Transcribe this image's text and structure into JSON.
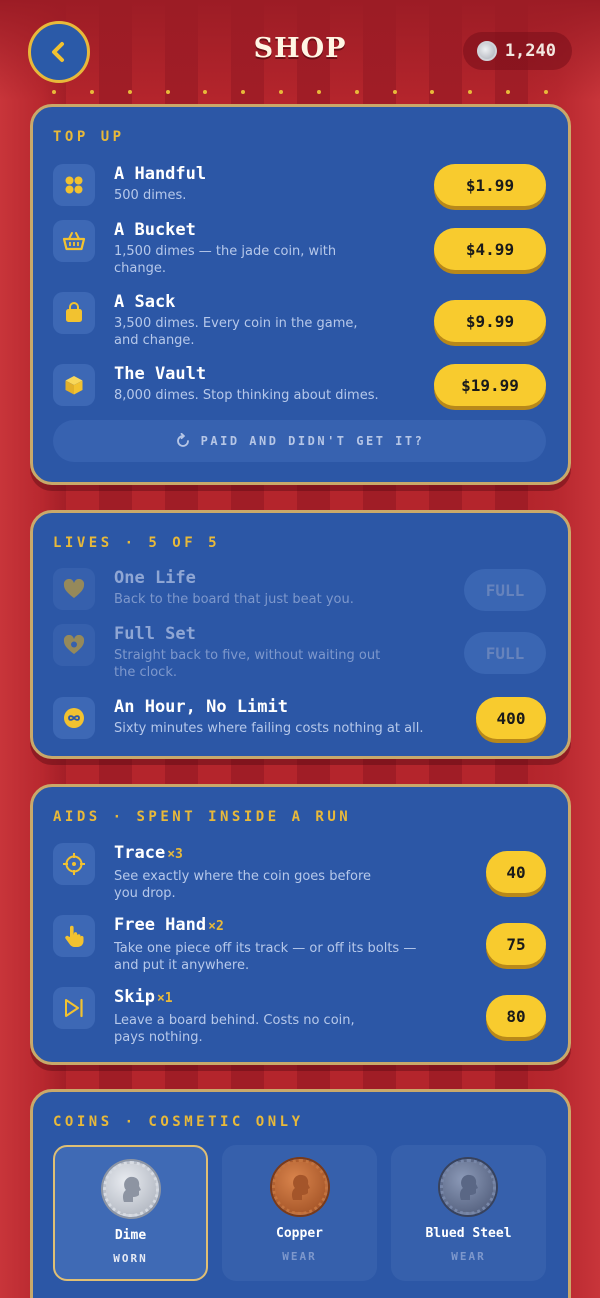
{
  "header": {
    "title": "SHOP",
    "balance": "1,240"
  },
  "topup": {
    "heading": "TOP UP",
    "items": [
      {
        "name": "A Handful",
        "desc": "500 dimes.",
        "price": "$1.99",
        "icon": "dots-cluster-icon"
      },
      {
        "name": "A Bucket",
        "desc": "1,500 dimes — the jade coin, with change.",
        "price": "$4.99",
        "icon": "basket-icon"
      },
      {
        "name": "A Sack",
        "desc": "3,500 dimes. Every coin in the game, and change.",
        "price": "$9.99",
        "icon": "bag-icon"
      },
      {
        "name": "The Vault",
        "desc": "8,000 dimes. Stop thinking about dimes.",
        "price": "$19.99",
        "icon": "cube-icon"
      }
    ],
    "restore_label": "PAID AND DIDN'T GET IT?"
  },
  "lives": {
    "heading": "LIVES · 5 OF 5",
    "items": [
      {
        "name": "One Life",
        "desc": "Back to the board that just beat you.",
        "price": "FULL",
        "icon": "heart-icon"
      },
      {
        "name": "Full Set",
        "desc": "Straight back to five, without waiting out the clock.",
        "price": "FULL",
        "icon": "heart-ring-icon"
      },
      {
        "name": "An Hour, No Limit",
        "desc": "Sixty minutes where failing costs nothing at all.",
        "price": "400",
        "icon": "infinity-icon"
      }
    ]
  },
  "aids": {
    "heading": "AIDS · SPENT INSIDE A RUN",
    "items": [
      {
        "name": "Trace",
        "mult": "×3",
        "desc": "See exactly where the coin goes before you drop.",
        "price": "40",
        "icon": "crosshair-icon"
      },
      {
        "name": "Free Hand",
        "mult": "×2",
        "desc": "Take one piece off its track — or off its bolts — and put it anywhere.",
        "price": "75",
        "icon": "hand-pointer-icon"
      },
      {
        "name": "Skip",
        "mult": "×1",
        "desc": "Leave a board behind. Costs no coin, pays nothing.",
        "price": "80",
        "icon": "skip-icon"
      }
    ]
  },
  "coins": {
    "heading": "COINS · COSMETIC ONLY",
    "items": [
      {
        "name": "Dime",
        "state": "WORN"
      },
      {
        "name": "Copper",
        "state": "WEAR"
      },
      {
        "name": "Blued Steel",
        "state": "WEAR"
      }
    ]
  }
}
